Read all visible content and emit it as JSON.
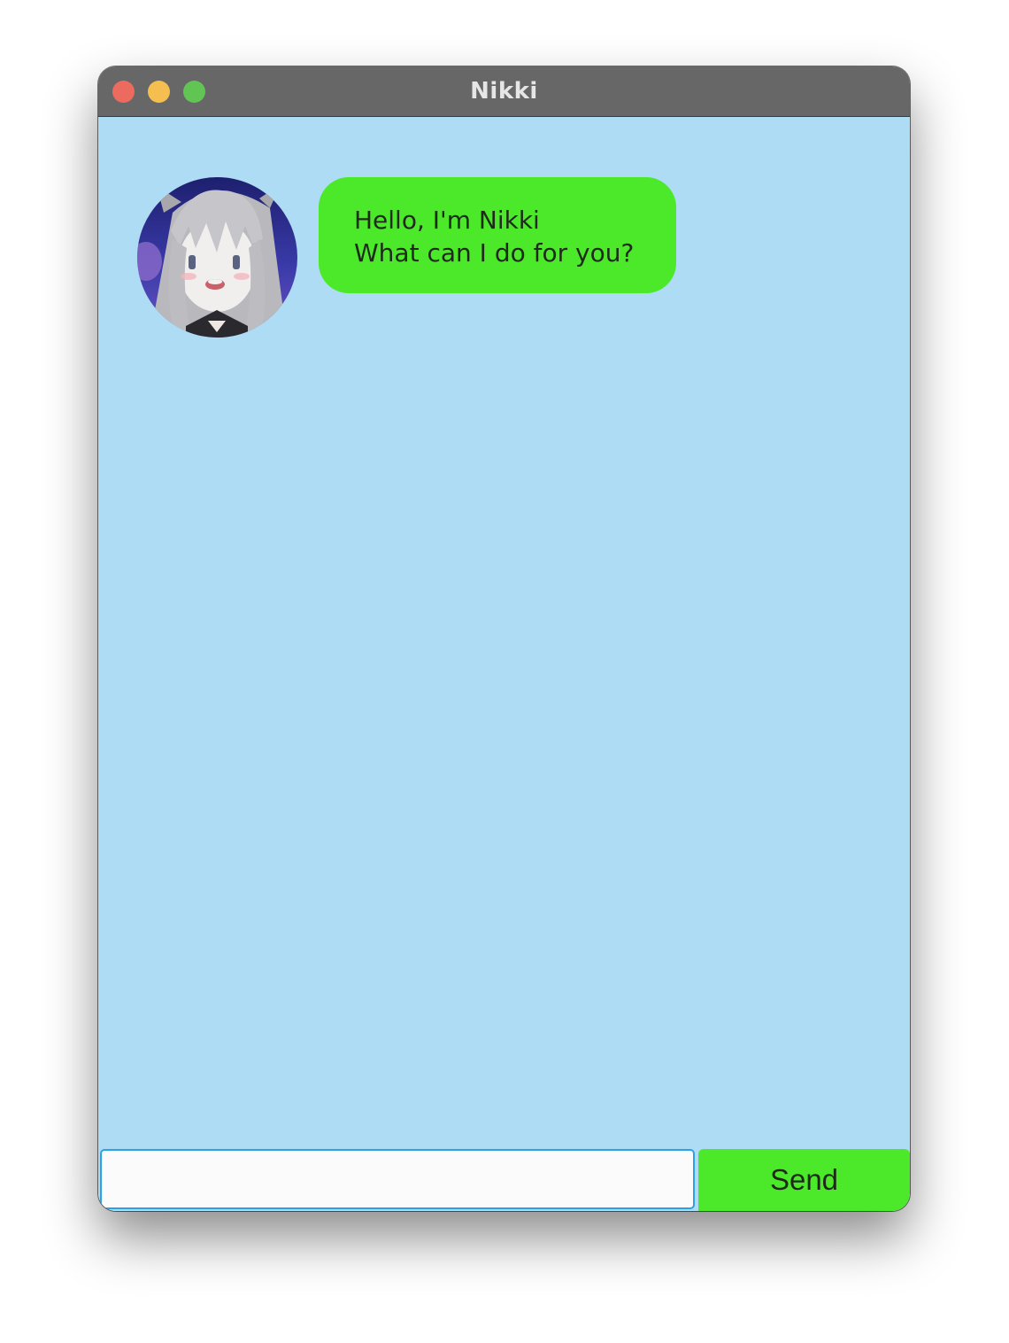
{
  "window": {
    "title": "Nikki"
  },
  "chat": {
    "messages": [
      {
        "sender": "bot",
        "avatar_icon": "anime-girl-avatar",
        "lines": [
          "Hello, I'm Nikki",
          "What can I do for you?"
        ]
      }
    ]
  },
  "input": {
    "value": "",
    "placeholder": ""
  },
  "send_button": {
    "label": "Send"
  },
  "colors": {
    "chat_background": "#aedcf5",
    "bubble": "#4ce92b",
    "send_button": "#4ce92b",
    "titlebar": "#686767",
    "input_border": "#2aa3e6"
  }
}
